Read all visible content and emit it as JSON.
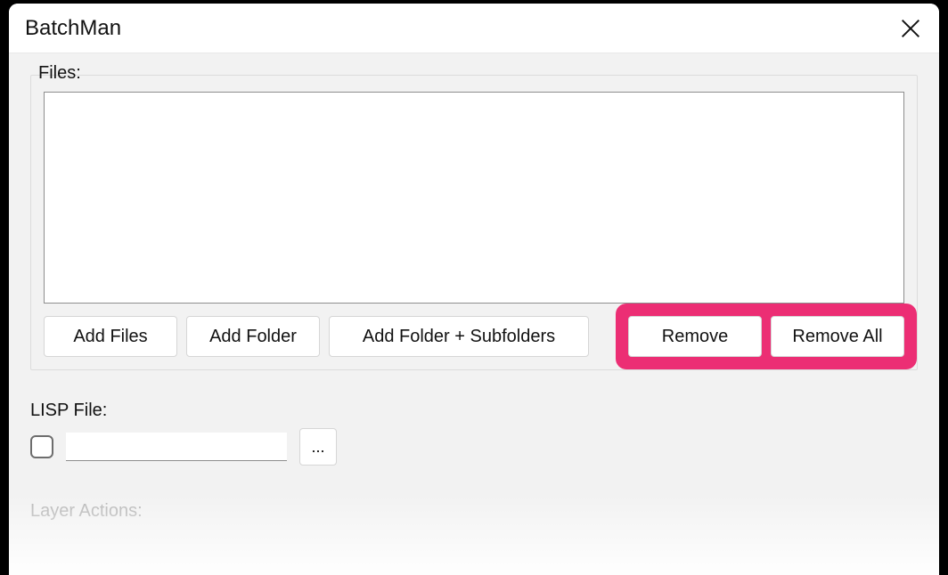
{
  "window": {
    "title": "BatchMan"
  },
  "files": {
    "legend": "Files:",
    "buttons": {
      "add_files": "Add Files",
      "add_folder": "Add Folder",
      "add_folder_subfolders": "Add Folder + Subfolders",
      "remove": "Remove",
      "remove_all": "Remove All"
    }
  },
  "lisp": {
    "label": "LISP File:",
    "value": "",
    "browse": "...",
    "checked": false
  },
  "layer_actions": {
    "label": "Layer Actions:"
  },
  "highlight": {
    "color": "#ec2e74"
  }
}
